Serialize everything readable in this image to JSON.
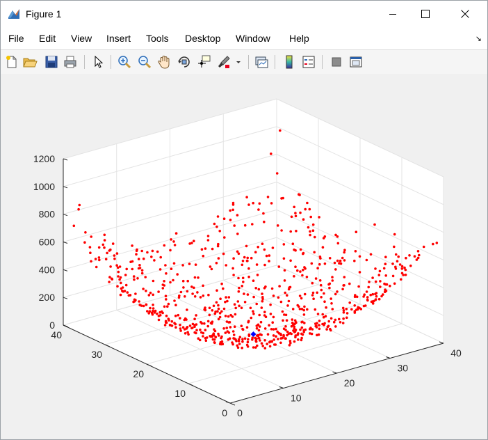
{
  "window": {
    "title": "Figure 1"
  },
  "menu": {
    "items": [
      "File",
      "Edit",
      "View",
      "Insert",
      "Tools",
      "Desktop",
      "Window",
      "Help"
    ]
  },
  "toolbar": {
    "tools": [
      "new-figure",
      "open-file",
      "save-figure",
      "print-figure",
      "edit-plot",
      "zoom-in",
      "zoom-out",
      "pan",
      "rotate-3d",
      "data-cursor",
      "brush",
      "brush-options",
      "link-plot",
      "insert-colorbar",
      "insert-legend",
      "hide-plot-tools",
      "show-plot-tools"
    ]
  },
  "chart_data": {
    "type": "scatter3d",
    "x_ticks": [
      0,
      10,
      20,
      30,
      40
    ],
    "y_ticks": [
      0,
      10,
      20,
      30,
      40
    ],
    "z_ticks": [
      0,
      200,
      400,
      600,
      800,
      1000,
      1200
    ],
    "xlim": [
      0,
      40
    ],
    "ylim": [
      0,
      40
    ],
    "zlim": [
      0,
      1200
    ],
    "grid": true,
    "series": [
      {
        "color": "#ff0000",
        "marker": "dot",
        "approx_count": 800,
        "surface": "z = (x - 20)^2 + (y - 20)^2 + noise"
      },
      {
        "color": "#0000ff",
        "marker": "diamond",
        "points": [
          [
            20,
            20,
            0
          ]
        ]
      }
    ]
  },
  "colors": {
    "titlebar": "#ffffff",
    "figure_bg": "#f0f0f0",
    "axes_bg": "#ffffff",
    "grid": "#e3e3e3",
    "axis": "#262626"
  }
}
